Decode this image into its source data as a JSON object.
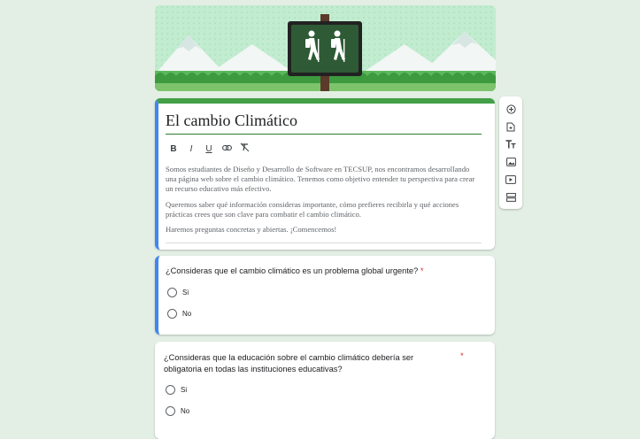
{
  "form": {
    "title": "El cambio Climático",
    "format_buttons": [
      "B",
      "I",
      "U"
    ],
    "description": [
      "Somos estudiantes de Diseño y Desarrollo de Software en TECSUP, nos encontramos desarrollando  una página web sobre el cambio climático. Tenemos como objetivo entender tu perspectiva para crear un recurso educativo más efectivo.",
      "Queremos saber qué información consideras importante, cómo prefieres recibirla y qué acciones prácticas crees que son clave para combatir el cambio climático.",
      "Haremos preguntas concretas y abiertas. ¡Comencemos!"
    ]
  },
  "questions": [
    {
      "text": "¿Consideras que el cambio climático es un problema global urgente?",
      "required_mark": "*",
      "options": [
        "Si",
        "No"
      ]
    },
    {
      "text": "¿Consideras que la educación sobre el cambio climático debería ser obligatoria en todas las instituciones educativas?",
      "required_mark": "*",
      "options": [
        "Si",
        "No"
      ]
    }
  ],
  "toolbar_icons": [
    "add-question-icon",
    "import-questions-icon",
    "add-title-icon",
    "add-image-icon",
    "add-video-icon",
    "add-section-icon"
  ],
  "colors": {
    "theme": "#43a047",
    "focus": "#4285f4",
    "required": "#d93025",
    "background": "#e3efe4"
  }
}
